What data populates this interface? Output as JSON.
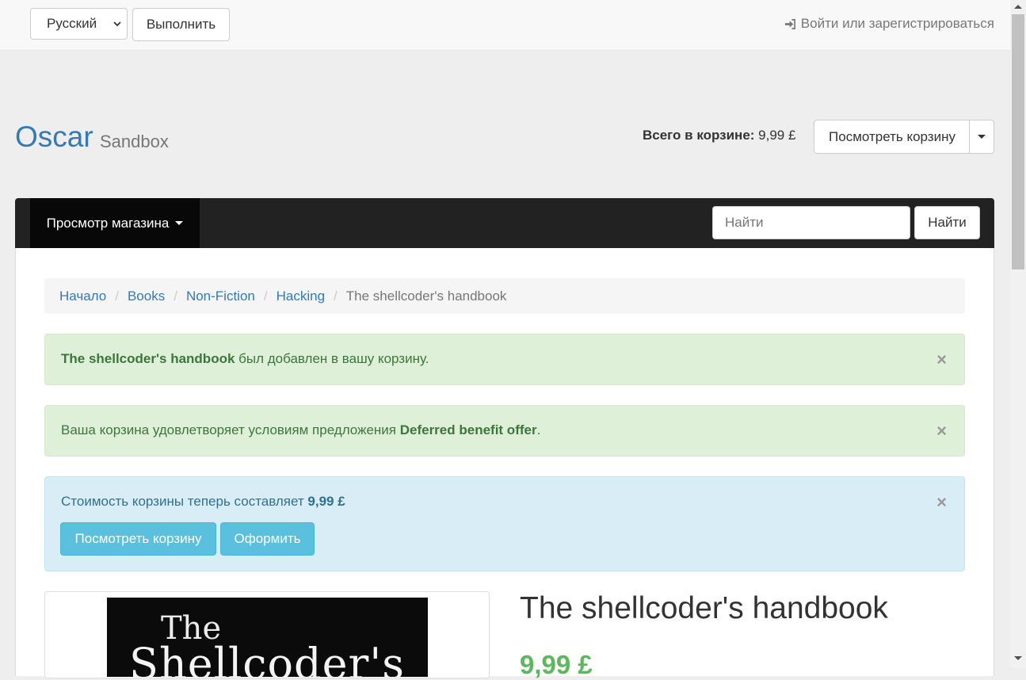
{
  "topbar": {
    "language_value": "Русский",
    "submit_label": "Выполнить",
    "login_label": "Войти или зарегистрироваться"
  },
  "header": {
    "brand": "Oscar",
    "brand_sub": "Sandbox",
    "basket_total_label": "Всего в корзине:",
    "basket_total_value": "9,99 £",
    "view_basket_label": "Посмотреть корзину"
  },
  "navbar": {
    "browse_label": "Просмотр магазина",
    "search_placeholder": "Найти",
    "search_button": "Найти"
  },
  "breadcrumb": {
    "items": [
      "Начало",
      "Books",
      "Non-Fiction",
      "Hacking"
    ],
    "active": "The shellcoder's handbook"
  },
  "alerts": {
    "added": {
      "product": "The shellcoder's handbook",
      "text": " был добавлен в вашу корзину."
    },
    "offer": {
      "text": "Ваша корзина удовлетворяет условиям предложения ",
      "offer_name": "Deferred benefit offer",
      "suffix": "."
    },
    "info": {
      "text": "Стоимость корзины теперь составляет ",
      "amount": "9,99 £",
      "view_basket_label": "Посмотреть корзину",
      "checkout_label": "Оформить"
    },
    "close_symbol": "×"
  },
  "product": {
    "cover_line1": "The",
    "cover_line2": "Shellcoder's",
    "title": "The shellcoder's handbook",
    "price": "9,99 £"
  },
  "colors": {
    "link": "#337ab7",
    "success_bg": "#dff0d8",
    "info_bg": "#d9edf7",
    "price": "#5cb85c",
    "navbar": "#222222"
  }
}
